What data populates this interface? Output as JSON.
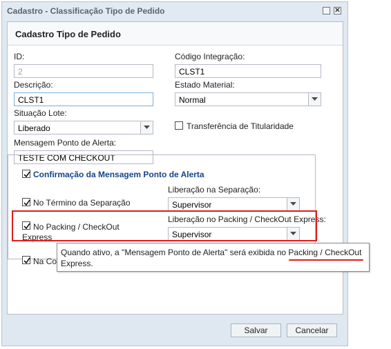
{
  "window": {
    "title": "Cadastro - Classificação Tipo de Pedido",
    "maximize_glyph": "□",
    "close_glyph": "✕"
  },
  "panel": {
    "title": "Cadastro Tipo de Pedido"
  },
  "form": {
    "id_label": "ID:",
    "id_value": "2",
    "codigo_label": "Código Integração:",
    "codigo_value": "CLST1",
    "descricao_label": "Descrição:",
    "descricao_value": "CLST1",
    "estado_label": "Estado Material:",
    "estado_value": "Normal",
    "situacao_label": "Situação Lote:",
    "situacao_value": "Liberado",
    "transferencia_label": "Transferência de Titularidade",
    "transferencia_checked": false,
    "mensagem_label": "Mensagem Ponto de Alerta:",
    "mensagem_value": "TESTE COM CHECKOUT"
  },
  "confirmacao": {
    "legend": "Confirmação da Mensagem Ponto de Alerta",
    "checked": true,
    "termino_label": "No Término da Separação",
    "termino_checked": true,
    "liberacao_separacao_label": "Liberação na Separação:",
    "liberacao_separacao_value": "Supervisor",
    "packing_label_line1": "No Packing / CheckOut",
    "packing_label_line2": "Express",
    "packing_checked": true,
    "liberacao_packing_label": "Liberação no Packing / CheckOut Express:",
    "liberacao_packing_value": "Supervisor",
    "third_label": "Na Col",
    "third_checked": true
  },
  "tooltip": {
    "line1_prefix": "Quando ativo, a \"Mensagem Ponto de Alerta\" será exibida no ",
    "line1_highlight": "Packing / CheckOut",
    "line2": "Express."
  },
  "buttons": {
    "save": "Salvar",
    "cancel": "Cancelar"
  },
  "colors": {
    "highlight": "#e11b1b",
    "legend": "#15428b"
  }
}
